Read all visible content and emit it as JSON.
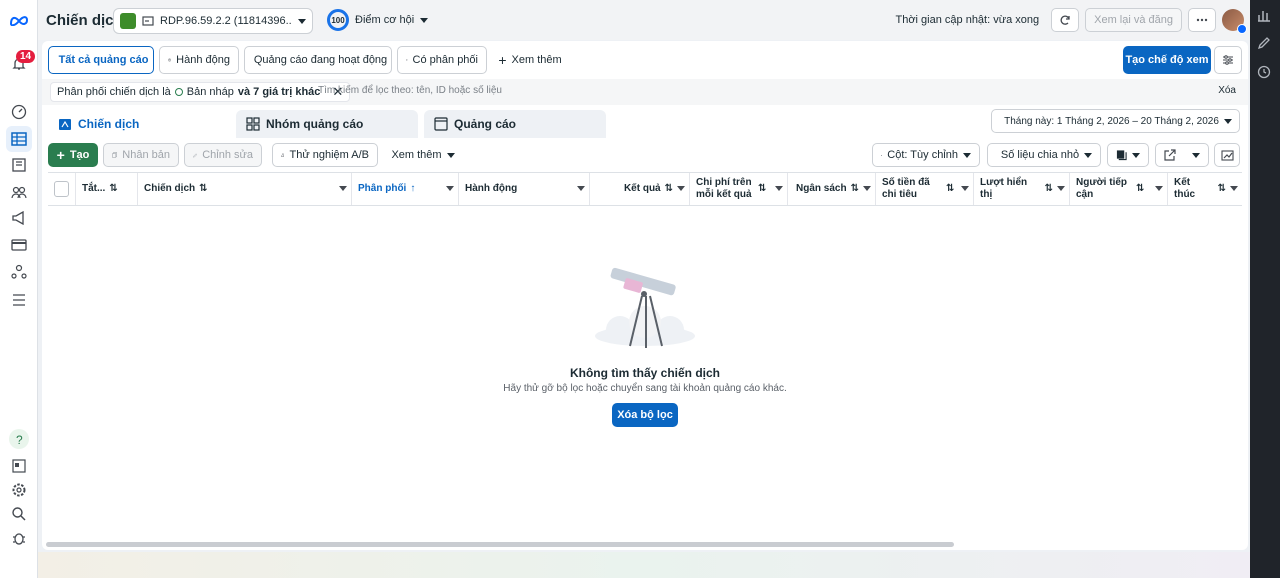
{
  "topbar": {
    "title": "Chiến dịch",
    "account": "RDP.96.59.2.2 (11814396...",
    "score_value": "100",
    "score_label": "Điểm cơ hội",
    "update_time": "Thời gian cập nhật: vừa xong",
    "review_publish": "Xem lại và đăng"
  },
  "notifications": {
    "count": "14"
  },
  "filters": {
    "all_ads": "Tất cả quảng cáo",
    "actions": "Hành động",
    "active_ads": "Quảng cáo đang hoạt động",
    "delivering": "Có phân phối",
    "see_more": "Xem thêm",
    "create_view": "Tạo chế độ xem",
    "chip_prefix": "Phân phối chiến dịch là",
    "chip_draft": "Bản nháp",
    "chip_more": "và 7 giá trị khác",
    "search_placeholder": "Tìm kiếm để lọc theo: tên, ID hoặc số liệu",
    "clear": "Xóa"
  },
  "tabs": {
    "campaigns": "Chiến dịch",
    "adsets": "Nhóm quảng cáo",
    "ads": "Quảng cáo",
    "date_range": "Tháng này: 1 Tháng 2, 2026 – 20 Tháng 2, 2026"
  },
  "toolbar": {
    "create": "Tạo",
    "duplicate": "Nhân bản",
    "edit": "Chỉnh sửa",
    "ab_test": "Thử nghiệm A/B",
    "more": "Xem thêm",
    "columns": "Cột: Tùy chỉnh",
    "breakdown": "Số liệu chia nhỏ"
  },
  "table": {
    "headers": {
      "all": "Tắt...",
      "campaign": "Chiến dịch",
      "delivery": "Phân phối",
      "actions": "Hành động",
      "results": "Kết quả",
      "cost_per_result": "Chi phí trên mỗi kết quả",
      "budget": "Ngân sách",
      "amount_spent": "Số tiền đã chi tiêu",
      "impressions": "Lượt hiển thị",
      "reach": "Người tiếp cận",
      "ends": "Kết thúc"
    }
  },
  "empty_state": {
    "title": "Không tìm thấy chiến dịch",
    "subtitle": "Hãy thử gỡ bộ lọc hoặc chuyển sang tài khoản quảng cáo khác.",
    "clear_filters": "Xóa bộ lọc"
  },
  "colors": {
    "primary": "#0a66c2",
    "create": "#2a7d4f",
    "accent": "#e41e3f"
  }
}
